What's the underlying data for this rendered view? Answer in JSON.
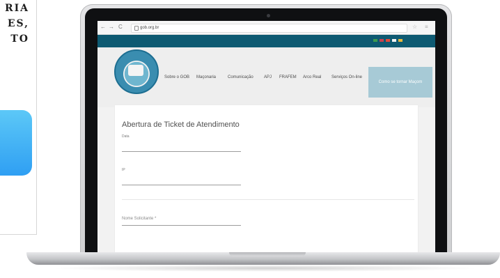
{
  "side_panel": {
    "lines": [
      "RIA",
      "ES,",
      "TO"
    ]
  },
  "browser": {
    "url": "gob.org.br",
    "back": "←",
    "forward": "→",
    "reload": "C",
    "star": "☆",
    "menu": "≡"
  },
  "site": {
    "nav": [
      "Sobre o GOB",
      "Maçonaria",
      "Comunicação",
      "APJ",
      "FRAFEM",
      "Arco Real",
      "Serviços On-line"
    ],
    "cta_label": "Como se tornar Maçom",
    "colors": {
      "topstrip": "#0e5a72",
      "cta": "#a7cad6"
    }
  },
  "form": {
    "title": "Abertura de Ticket de Atendimento",
    "fields": [
      {
        "label": "Data"
      },
      {
        "label": "IP"
      },
      {
        "label": "Nome Solicitante *"
      }
    ]
  }
}
